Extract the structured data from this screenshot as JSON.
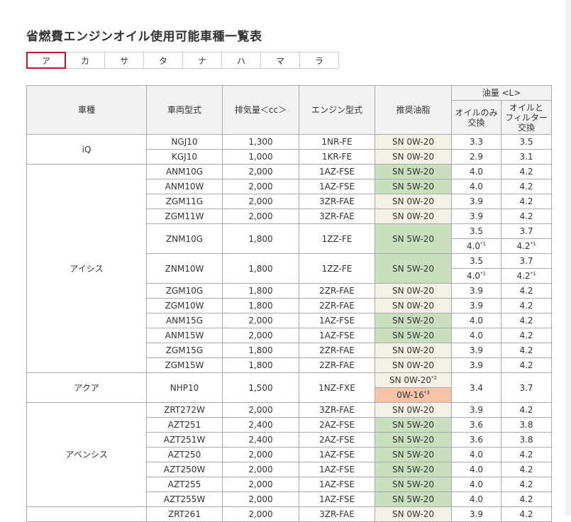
{
  "title": "省燃費エンジンオイル使用可能車種一覧表",
  "tabs": [
    {
      "label": "ア",
      "active": true
    },
    {
      "label": "カ"
    },
    {
      "label": "サ"
    },
    {
      "label": "タ"
    },
    {
      "label": "ナ"
    },
    {
      "label": "ハ"
    },
    {
      "label": "マ"
    },
    {
      "label": "ラ"
    }
  ],
  "headers": {
    "car": "車種",
    "model": "車両型式",
    "displacement": "排気量＜cc＞",
    "engine": "エンジン型式",
    "oil": "推奨油脂",
    "amount": "油量 <L>",
    "oil_only": "オイルのみ交換",
    "with_filter": "オイルとフィルター交換"
  },
  "colors": {
    "sn0w20": "#f3f1e6",
    "sn5w20": "#c8e0bd",
    "ow16": "#f7c3a8",
    "tab_active_border": "#c8102e"
  },
  "groups": [
    {
      "car": "iQ",
      "rows": [
        {
          "model": "NGJ10",
          "cc": "1,300",
          "engine": "1NR-FE",
          "oil": "SN 0W-20",
          "amt": [
            [
              "3.3",
              "3.5"
            ]
          ]
        },
        {
          "model": "KGJ10",
          "cc": "1,000",
          "engine": "1KR-FE",
          "oil": "SN 0W-20",
          "amt": [
            [
              "2.9",
              "3.1"
            ]
          ]
        }
      ]
    },
    {
      "car": "アイシス",
      "rows": [
        {
          "model": "ANM10G",
          "cc": "2,000",
          "engine": "1AZ-FSE",
          "oil": "SN 5W-20",
          "amt": [
            [
              "4.0",
              "4.2"
            ]
          ]
        },
        {
          "model": "ANM10W",
          "cc": "2,000",
          "engine": "1AZ-FSE",
          "oil": "SN 5W-20",
          "amt": [
            [
              "4.0",
              "4.2"
            ]
          ]
        },
        {
          "model": "ZGM11G",
          "cc": "2,000",
          "engine": "3ZR-FAE",
          "oil": "SN 0W-20",
          "amt": [
            [
              "3.9",
              "4.2"
            ]
          ]
        },
        {
          "model": "ZGM11W",
          "cc": "2,000",
          "engine": "3ZR-FAE",
          "oil": "SN 0W-20",
          "amt": [
            [
              "3.9",
              "4.2"
            ]
          ]
        },
        {
          "model": "ZNM10G",
          "cc": "1,800",
          "engine": "1ZZ-FE",
          "oil": "SN 5W-20",
          "amt": [
            [
              "3.5",
              "3.7"
            ],
            [
              "4.0",
              "4.2"
            ]
          ]
        },
        {
          "model": "ZNM10W",
          "cc": "1,800",
          "engine": "1ZZ-FE",
          "oil": "SN 5W-20",
          "amt": [
            [
              "3.5",
              "3.7"
            ],
            [
              "4.0",
              "4.2"
            ]
          ]
        },
        {
          "model": "ZGM10G",
          "cc": "1,800",
          "engine": "2ZR-FAE",
          "oil": "SN 0W-20",
          "amt": [
            [
              "3.9",
              "4.2"
            ]
          ]
        },
        {
          "model": "ZGM10W",
          "cc": "1,800",
          "engine": "2ZR-FAE",
          "oil": "SN 0W-20",
          "amt": [
            [
              "3.9",
              "4.2"
            ]
          ]
        },
        {
          "model": "ANM15G",
          "cc": "2,000",
          "engine": "1AZ-FSE",
          "oil": "SN 5W-20",
          "amt": [
            [
              "4.0",
              "4.2"
            ]
          ]
        },
        {
          "model": "ANM15W",
          "cc": "2,000",
          "engine": "1AZ-FSE",
          "oil": "SN 5W-20",
          "amt": [
            [
              "4.0",
              "4.2"
            ]
          ]
        },
        {
          "model": "ZGM15G",
          "cc": "1,800",
          "engine": "2ZR-FAE",
          "oil": "SN 0W-20",
          "amt": [
            [
              "3.9",
              "4.2"
            ]
          ]
        },
        {
          "model": "ZGM15W",
          "cc": "1,800",
          "engine": "2ZR-FAE",
          "oil": "SN 0W-20",
          "amt": [
            [
              "3.9",
              "4.2"
            ]
          ]
        }
      ]
    },
    {
      "car": "アクア",
      "rows": [
        {
          "model": "NHP10",
          "cc": "1,500",
          "engine": "1NZ-FXE",
          "oil": "SN 0W-20",
          "oil2": "0W-16",
          "amt": [
            [
              "3.4",
              "3.7"
            ]
          ]
        }
      ]
    },
    {
      "car": "アベンシス",
      "rows": [
        {
          "model": "ZRT272W",
          "cc": "2,000",
          "engine": "3ZR-FAE",
          "oil": "SN 0W-20",
          "amt": [
            [
              "3.9",
              "4.2"
            ]
          ]
        },
        {
          "model": "AZT251",
          "cc": "2,400",
          "engine": "2AZ-FSE",
          "oil": "SN 5W-20",
          "amt": [
            [
              "3.6",
              "3.8"
            ]
          ]
        },
        {
          "model": "AZT251W",
          "cc": "2,400",
          "engine": "2AZ-FSE",
          "oil": "SN 5W-20",
          "amt": [
            [
              "3.6",
              "3.8"
            ]
          ]
        },
        {
          "model": "AZT250",
          "cc": "2,000",
          "engine": "1AZ-FSE",
          "oil": "SN 5W-20",
          "amt": [
            [
              "4.0",
              "4.2"
            ]
          ]
        },
        {
          "model": "AZT250W",
          "cc": "2,000",
          "engine": "1AZ-FSE",
          "oil": "SN 5W-20",
          "amt": [
            [
              "4.0",
              "4.2"
            ]
          ]
        },
        {
          "model": "AZT255",
          "cc": "2,000",
          "engine": "1AZ-FSE",
          "oil": "SN 5W-20",
          "amt": [
            [
              "4.0",
              "4.2"
            ]
          ]
        },
        {
          "model": "AZT255W",
          "cc": "2,000",
          "engine": "1AZ-FSE",
          "oil": "SN 5W-20",
          "amt": [
            [
              "4.0",
              "4.2"
            ]
          ]
        }
      ]
    },
    {
      "car": "",
      "rows": [
        {
          "model": "ZRT261",
          "cc": "2,000",
          "engine": "3ZR-FAE",
          "oil": "SN 0W-20",
          "amt": [
            [
              "3.9",
              "4.2"
            ]
          ]
        }
      ]
    }
  ]
}
